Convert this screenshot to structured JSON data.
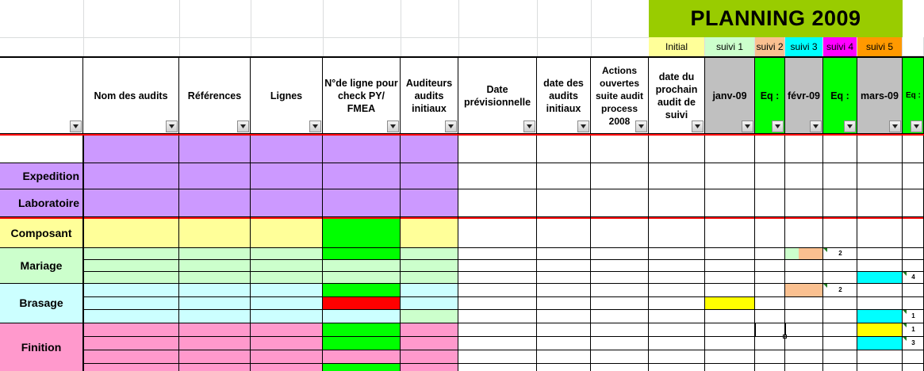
{
  "title": "PLANNING 2009",
  "suivi_labels": [
    {
      "label": "Initial",
      "color": "#ffff99"
    },
    {
      "label": "suivi 1",
      "color": "#ccffcc"
    },
    {
      "label": "suivi 2",
      "color": "#fac090"
    },
    {
      "label": "suivi 3",
      "color": "#00ffff"
    },
    {
      "label": "suivi 4",
      "color": "#ff00ff"
    },
    {
      "label": "suivi 5",
      "color": "#ff9900"
    }
  ],
  "headers": [
    "",
    "Nom des audits",
    "Références",
    "Lignes",
    "N°de ligne pour check PY/ FMEA",
    "Auditeurs audits initiaux",
    "Date prévisionnelle",
    "date des audits initiaux",
    "Actions ouvertes suite audit process 2008",
    "date du prochain audit de suivi",
    "janv-09",
    "Eq :",
    "févr-09",
    "Eq :",
    "mars-09",
    "Eq :"
  ],
  "groups": [
    "Expedition",
    "Laboratoire",
    "Composant",
    "Mariage",
    "Brasage",
    "Finition"
  ],
  "counts": [
    "2",
    "4",
    "2",
    "1",
    "1",
    "3"
  ],
  "colors": {
    "purple": "#cc99ff",
    "yellow": "#ffff99",
    "light_green": "#ccffcc",
    "light_cyan": "#ccffff",
    "pink": "#ff99cc",
    "green": "#00ff00",
    "red": "#ff0000",
    "peach": "#fac090",
    "cyan": "#00ffff",
    "bright_yellow": "#ffff00",
    "gray": "#c0c0c0",
    "title_green": "#99cc00"
  }
}
